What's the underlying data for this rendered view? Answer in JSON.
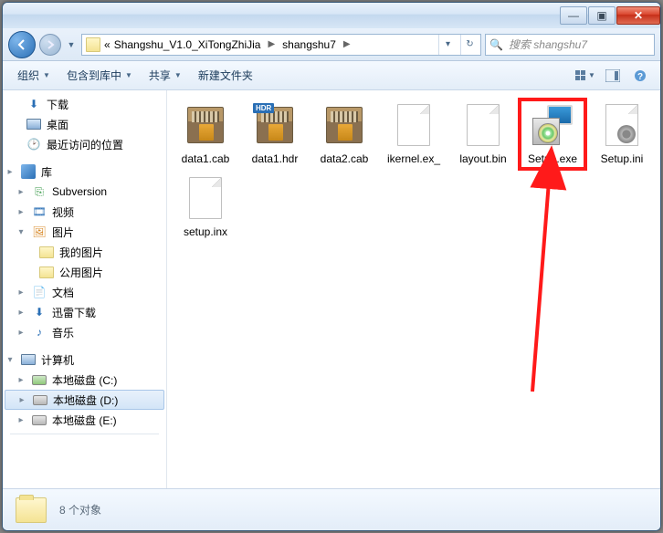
{
  "window": {
    "min": "—",
    "max": "▣",
    "close": "✕"
  },
  "address": {
    "prefix": "«",
    "crumbs": [
      "Shangshu_V1.0_XiTongZhiJia",
      "shangshu7"
    ]
  },
  "search": {
    "placeholder": "搜索 shangshu7"
  },
  "toolbar": {
    "organize": "组织",
    "include": "包含到库中",
    "share": "共享",
    "newfolder": "新建文件夹"
  },
  "sidebar": {
    "downloads": "下载",
    "desktop": "桌面",
    "recent": "最近访问的位置",
    "libraries": "库",
    "subversion": "Subversion",
    "videos": "视频",
    "pictures": "图片",
    "mypictures": "我的图片",
    "publicpictures": "公用图片",
    "documents": "文档",
    "xunlei": "迅雷下载",
    "music": "音乐",
    "computer": "计算机",
    "drive_c": "本地磁盘 (C:)",
    "drive_d": "本地磁盘 (D:)",
    "drive_e": "本地磁盘 (E:)"
  },
  "files": [
    {
      "name": "data1.cab",
      "icon": "cab"
    },
    {
      "name": "data1.hdr",
      "icon": "hdr"
    },
    {
      "name": "data2.cab",
      "icon": "cab"
    },
    {
      "name": "ikernel.ex_",
      "icon": "blank"
    },
    {
      "name": "layout.bin",
      "icon": "blank"
    },
    {
      "name": "Setup.exe",
      "icon": "setup",
      "highlight": true
    },
    {
      "name": "Setup.ini",
      "icon": "ini"
    },
    {
      "name": "setup.inx",
      "icon": "blank"
    }
  ],
  "status": {
    "count": "8 个对象"
  },
  "hdr_badge": "HDR"
}
